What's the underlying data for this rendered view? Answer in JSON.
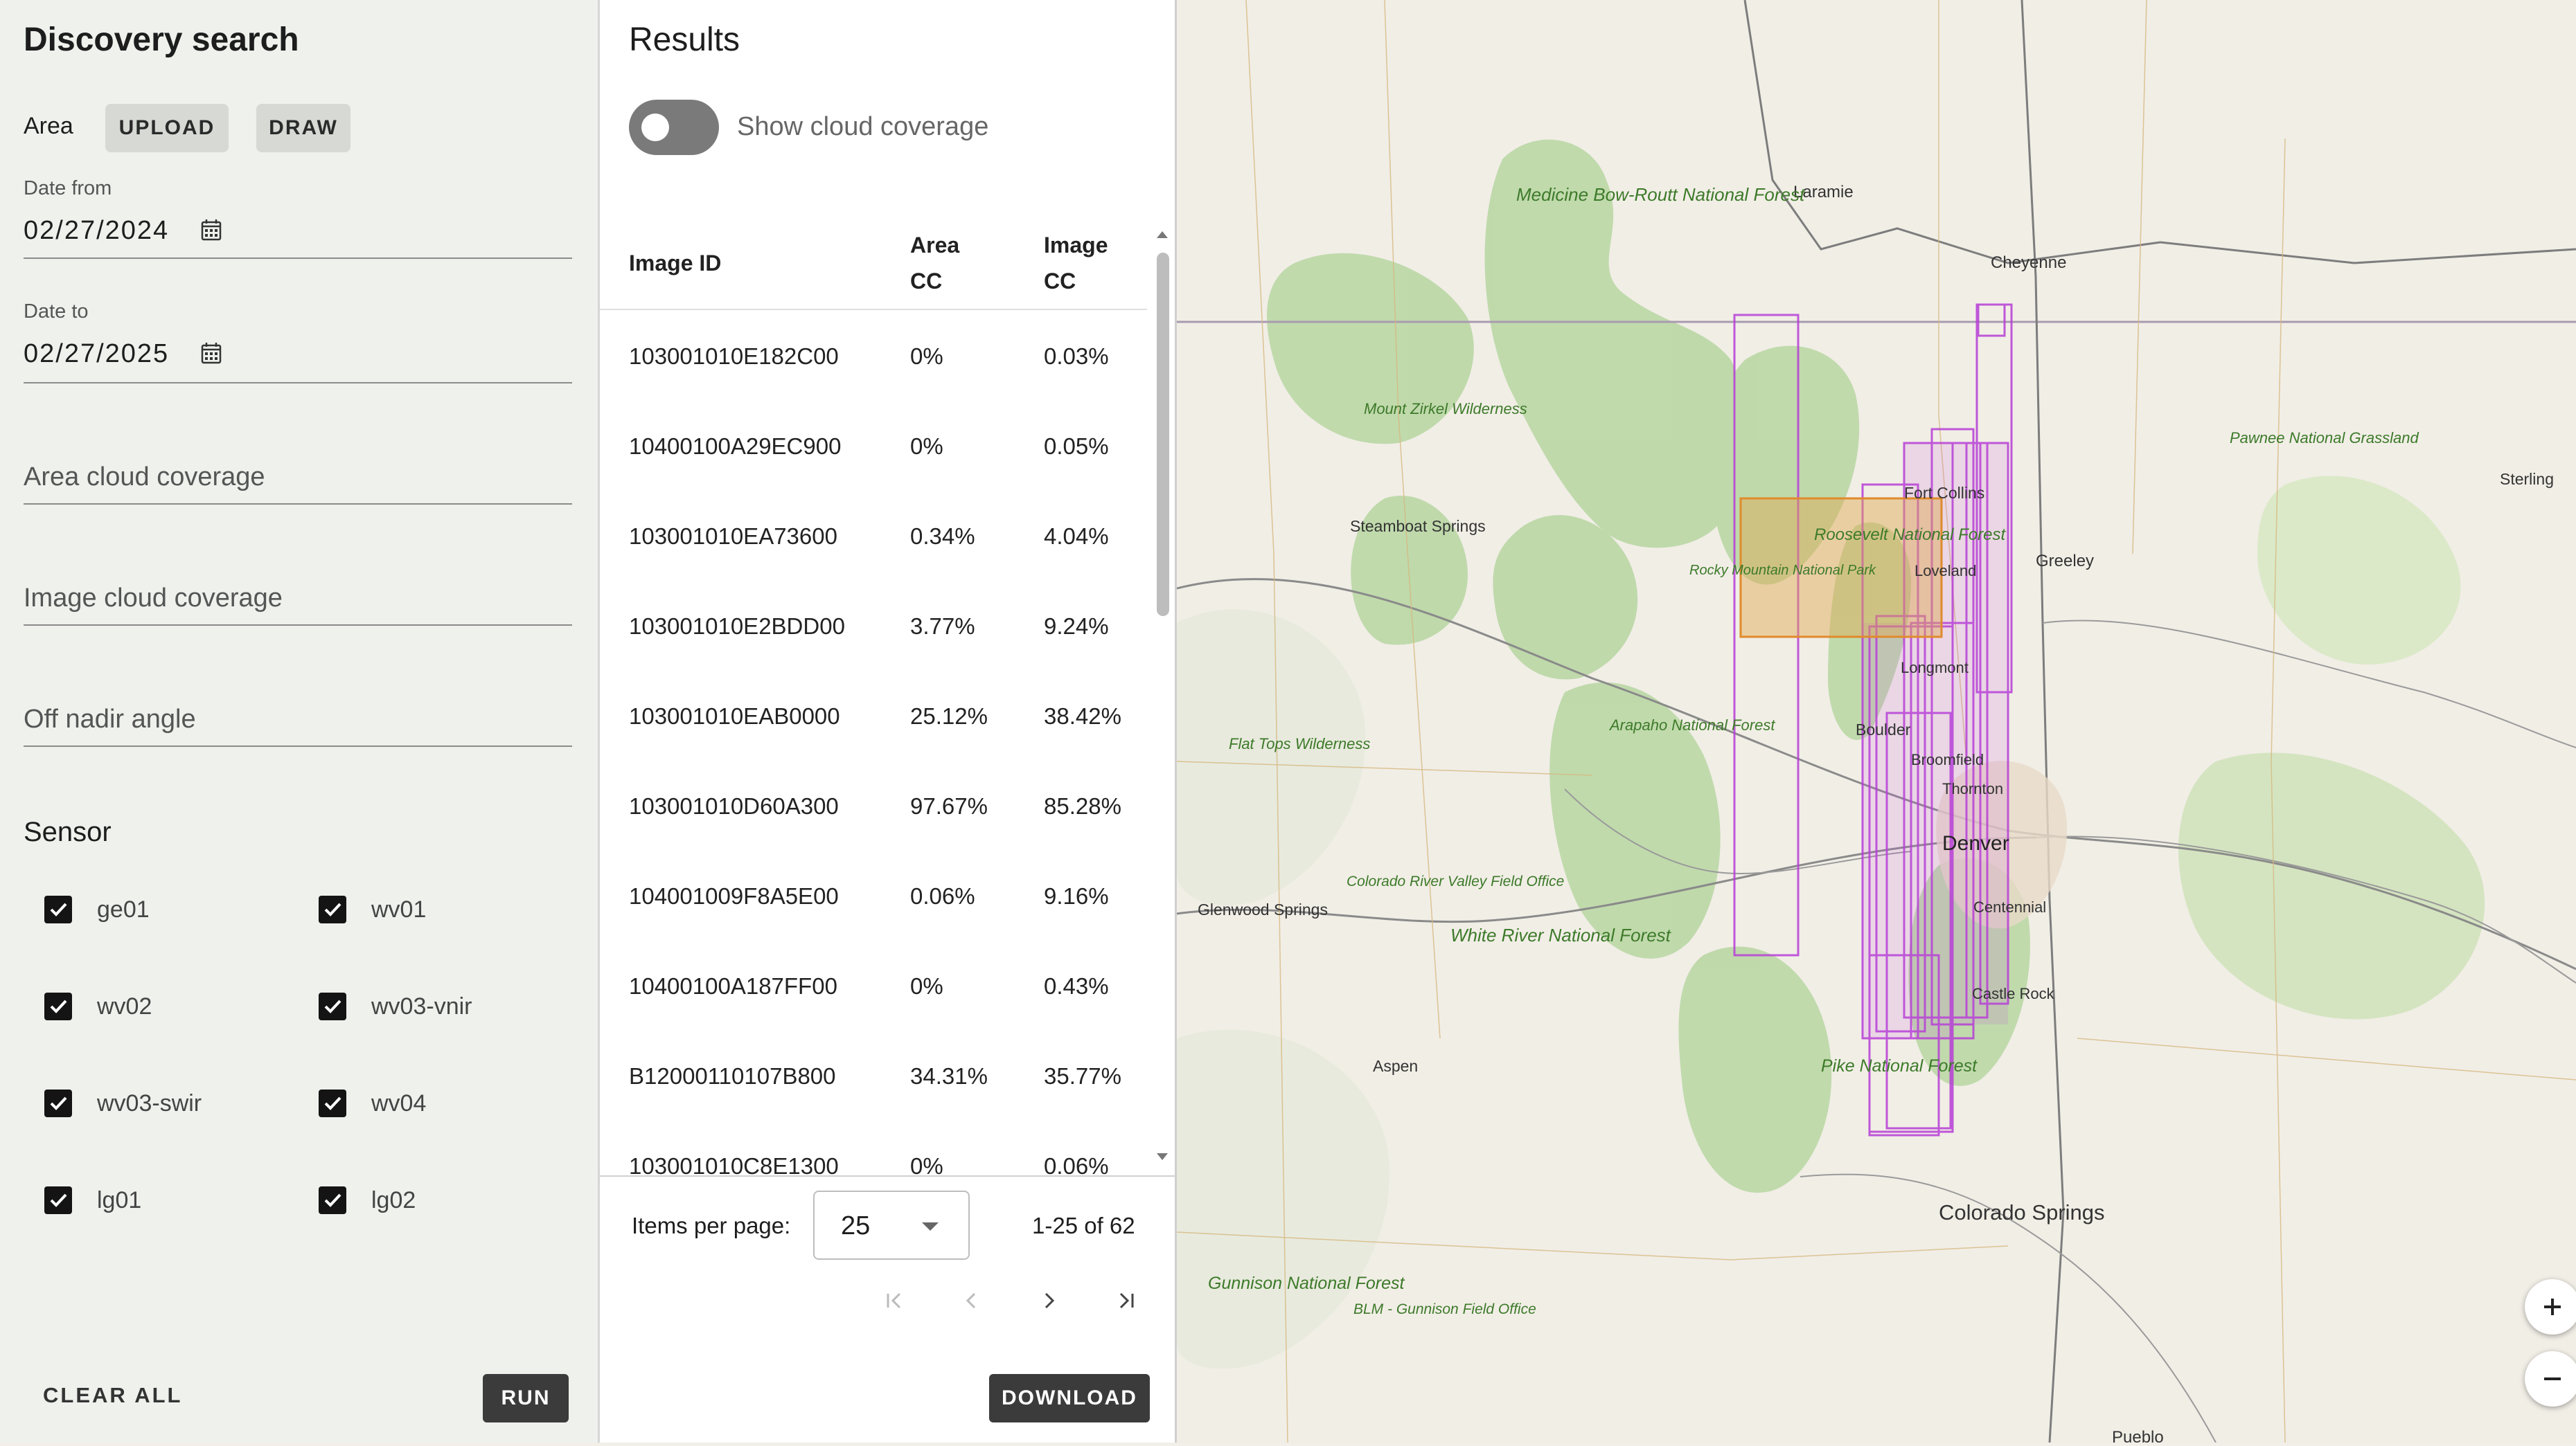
{
  "search": {
    "title": "Discovery search",
    "area_label": "Area",
    "upload_label": "UPLOAD",
    "draw_label": "DRAW",
    "date_from_label": "Date from",
    "date_from_value": "02/27/2024",
    "date_to_label": "Date to",
    "date_to_value": "02/27/2025",
    "area_cc_placeholder": "Area cloud coverage",
    "image_cc_placeholder": "Image cloud coverage",
    "off_nadir_placeholder": "Off nadir angle",
    "sensor_title": "Sensor",
    "sensors": [
      {
        "label": "ge01",
        "checked": true
      },
      {
        "label": "wv01",
        "checked": true
      },
      {
        "label": "wv02",
        "checked": true
      },
      {
        "label": "wv03-vnir",
        "checked": true
      },
      {
        "label": "wv03-swir",
        "checked": true
      },
      {
        "label": "wv04",
        "checked": true
      },
      {
        "label": "lg01",
        "checked": true
      },
      {
        "label": "lg02",
        "checked": true
      }
    ],
    "clear_all_label": "CLEAR ALL",
    "run_label": "RUN"
  },
  "results": {
    "title": "Results",
    "toggle_label": "Show cloud coverage",
    "toggle_on": false,
    "columns": {
      "image_id": "Image ID",
      "area_cc_1": "Area",
      "area_cc_2": "CC",
      "image_cc_1": "Image",
      "image_cc_2": "CC"
    },
    "rows": [
      {
        "id": "103001010E182C00",
        "area_cc": "0%",
        "image_cc": "0.03%"
      },
      {
        "id": "10400100A29EC900",
        "area_cc": "0%",
        "image_cc": "0.05%"
      },
      {
        "id": "103001010EA73600",
        "area_cc": "0.34%",
        "image_cc": "4.04%"
      },
      {
        "id": "103001010E2BDD00",
        "area_cc": "3.77%",
        "image_cc": "9.24%"
      },
      {
        "id": "103001010EAB0000",
        "area_cc": "25.12%",
        "image_cc": "38.42%"
      },
      {
        "id": "103001010D60A300",
        "area_cc": "97.67%",
        "image_cc": "85.28%"
      },
      {
        "id": "104001009F8A5E00",
        "area_cc": "0.06%",
        "image_cc": "9.16%"
      },
      {
        "id": "10400100A187FF00",
        "area_cc": "0%",
        "image_cc": "0.43%"
      },
      {
        "id": "B12000110107B800",
        "area_cc": "34.31%",
        "image_cc": "35.77%"
      },
      {
        "id": "103001010C8E1300",
        "area_cc": "0%",
        "image_cc": "0.06%"
      }
    ],
    "items_per_page_label": "Items per page:",
    "items_per_page": "25",
    "range_label": "1-25 of 62",
    "download_label": "DOWNLOAD"
  },
  "map": {
    "labels": {
      "laramie": "Laramie",
      "cheyenne": "Cheyenne",
      "medicine_bow": "Medicine Bow-Routt National Forest",
      "mount_zirkel": "Mount Zirkel Wilderness",
      "steamboat": "Steamboat Springs",
      "fort_collins": "Fort Collins",
      "roosevelt": "Roosevelt National Forest",
      "rocky_mountain": "Rocky Mountain National Park",
      "loveland": "Loveland",
      "greeley": "Greeley",
      "pawnee": "Pawnee National Grassland",
      "sterling": "Sterling",
      "longmont": "Longmont",
      "boulder": "Boulder",
      "arapaho": "Arapaho National Forest",
      "flat_tops": "Flat Tops Wilderness",
      "broomfield": "Broomfield",
      "thornton": "Thornton",
      "denver": "Denver",
      "centennial": "Centennial",
      "glenwood": "Glenwood Springs",
      "colorado_river": "Colorado River Valley Field Office",
      "white_river": "White River National Forest",
      "castle_rock": "Castle Rock",
      "aspen": "Aspen",
      "pike": "Pike National Forest",
      "colorado_springs": "Colorado Springs",
      "gunnison": "Gunnison National Forest",
      "blm_gunnison": "BLM - Gunnison Field Office",
      "pueblo": "Pueblo"
    },
    "zoom_in": "+",
    "zoom_out": "−"
  }
}
